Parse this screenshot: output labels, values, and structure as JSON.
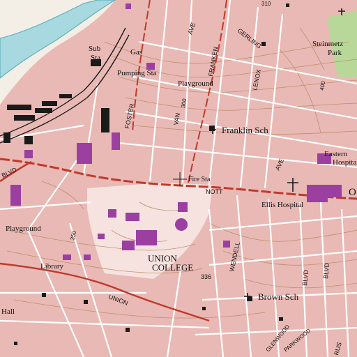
{
  "map": {
    "colors": {
      "urban_tint": "#e9b9b5",
      "river": "#a8d8e0",
      "river_bank": "#5fb0b8",
      "land_plain": "#f3efe6",
      "park_green": "#b8d89a",
      "building_purple": "#9b3fa0",
      "building_black": "#1a1a1a",
      "road_major": "#c0392b",
      "road_minor": "#ffffff",
      "contour": "#b7865e",
      "campus_tint": "#f6e3e0"
    },
    "labels": {
      "sub_sta": "Sub",
      "sub_sta2": "Sta",
      "gas": "Gas",
      "pumping_sta": "Pumping Sta",
      "playground_top": "Playground",
      "foster": "FOSTER",
      "van": "VAN",
      "franken": "FRANKEN",
      "ave_top": "AVE",
      "gerling": "GERLING",
      "steinmetz": "Steinmetz",
      "park": "Park",
      "num_300": "300",
      "num_400": "400",
      "lenox": "LENOX",
      "franklin_sch": "Franklin Sch",
      "eastern": "Eastern",
      "hospital": "Hospital",
      "ave_right": "AVE",
      "fire_sta": "Fire Sta",
      "nott": "NOTT",
      "ellis_hospital": "Ellis Hospital",
      "blvd_left": "BLVD",
      "playground_left": "Playground",
      "library": "Library",
      "num_350": "350",
      "union_college_1": "UNION",
      "union_college_2": "COLLEGE",
      "wendell": "WENDELL",
      "num_336": "336",
      "union_st": "UNION",
      "hall": "Hall",
      "brown_sch": "Brown Sch",
      "glenwood": "GLENWOOD",
      "parkwood": "PARKWOOD",
      "blvd_right1": "BLVD",
      "blvd_right2": "BLVD",
      "rus": "RUS",
      "num_310": "310",
      "right_o": "O"
    }
  }
}
